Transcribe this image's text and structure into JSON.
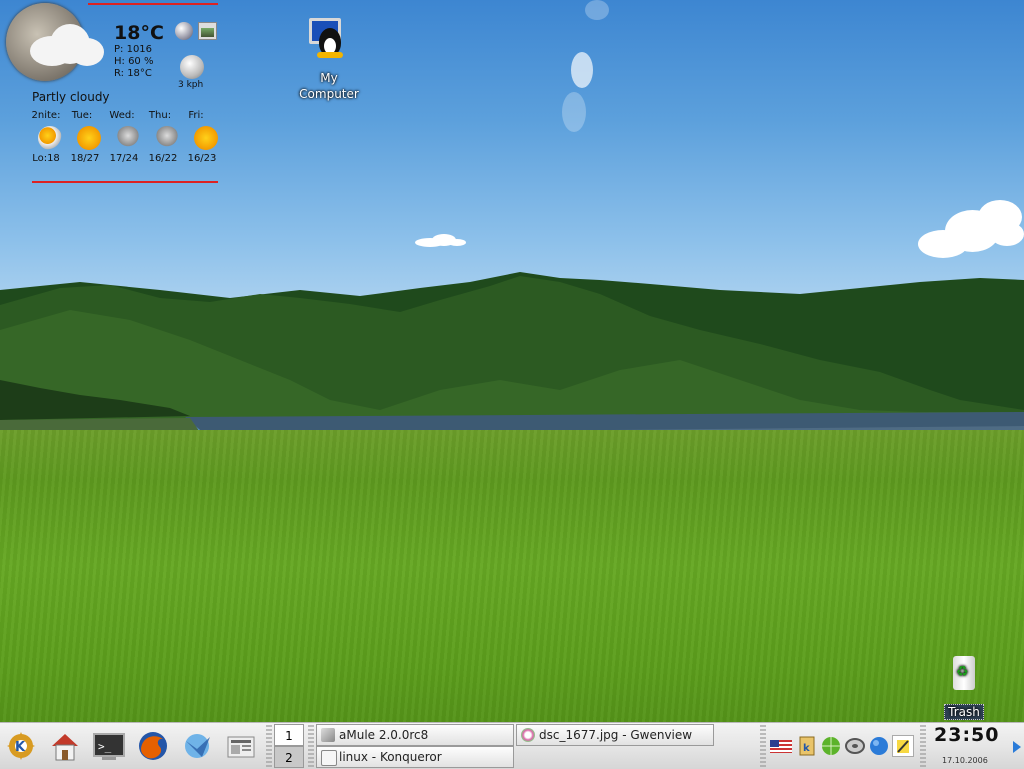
{
  "weather": {
    "temperature": "18°C",
    "pressure": "P: 1016",
    "humidity": "H: 60 %",
    "realfeel": "R: 18°C",
    "wind_speed": "3 kph",
    "condition": "Partly cloudy",
    "forecast": [
      {
        "day": "2nite:",
        "range": "Lo:18",
        "icon": "partly-cloudy-icon"
      },
      {
        "day": "Tue:",
        "range": "18/27",
        "icon": "sun-icon"
      },
      {
        "day": "Wed:",
        "range": "17/24",
        "icon": "rain-icon"
      },
      {
        "day": "Thu:",
        "range": "16/22",
        "icon": "rain-icon"
      },
      {
        "day": "Fri:",
        "range": "16/23",
        "icon": "sun-icon"
      }
    ]
  },
  "desktop": {
    "my_computer_label": "My Computer",
    "trash_label": "Trash"
  },
  "panel": {
    "launchers": [
      "kde-menu-icon",
      "home-icon",
      "terminal-icon",
      "firefox-icon",
      "email-icon",
      "news-icon"
    ],
    "desktops": [
      "1",
      "2"
    ],
    "tasks": {
      "amule": "aMule 2.0.0rc8",
      "gwenview": "dsc_1677.jpg - Gwenview",
      "konqueror": "linux - Konqueror"
    },
    "tray_icons": [
      "us-flag-icon",
      "klipper-icon",
      "network-icon",
      "cd-icon",
      "globe-icon",
      "notes-icon"
    ],
    "clock": "23:50",
    "date": "17.10.2006"
  },
  "colors": {
    "panel_top": "#f3f3f3",
    "panel_bottom": "#d6d6d6",
    "weather_rule": "#dd2222",
    "sky": "#5ca0dc",
    "field": "#66a823"
  }
}
